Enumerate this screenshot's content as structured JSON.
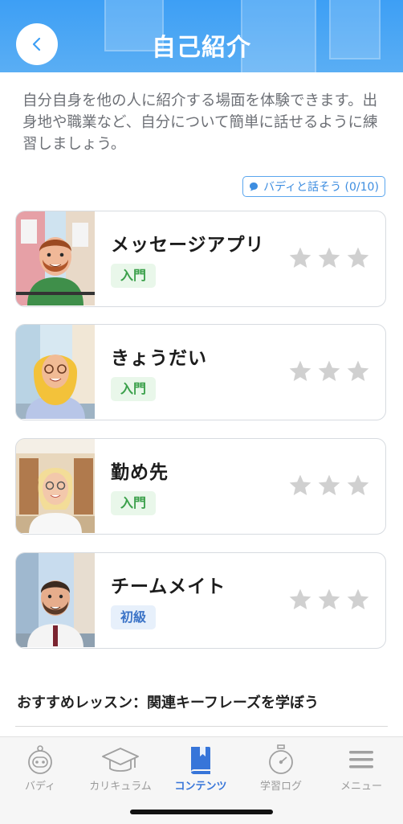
{
  "header": {
    "title": "自己紹介"
  },
  "description": "自分自身を他の人に紹介する場面を体験できます。出身地や職業など、自分について簡単に話せるように練習しましょう。",
  "buddy_badge": {
    "label": "バディと話そう (0/10)"
  },
  "lessons": [
    {
      "title": "メッセージアプリ",
      "level": "入門",
      "stars": 0
    },
    {
      "title": "きょうだい",
      "level": "入門",
      "stars": 0
    },
    {
      "title": "勤め先",
      "level": "入門",
      "stars": 0
    },
    {
      "title": "チームメイト",
      "level": "初級",
      "stars": 0
    }
  ],
  "recommended": {
    "heading": "おすすめレッスン：関連キーフレーズを学ぼう"
  },
  "tabbar": {
    "items": [
      {
        "label": "バディ",
        "icon": "buddy-robot-icon"
      },
      {
        "label": "カリキュラム",
        "icon": "graduation-cap-icon"
      },
      {
        "label": "コンテンツ",
        "icon": "book-icon",
        "active": true
      },
      {
        "label": "学習ログ",
        "icon": "stopwatch-icon"
      },
      {
        "label": "メニュー",
        "icon": "menu-icon"
      }
    ]
  },
  "colors": {
    "header": "#3d9ff5",
    "active_tab": "#3775d9",
    "star": "#d0d0d0",
    "beginner": "#3aa04a",
    "elementary": "#3c74c7"
  }
}
